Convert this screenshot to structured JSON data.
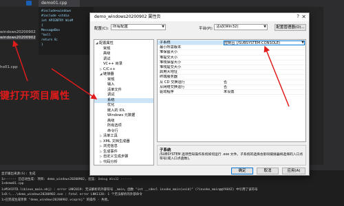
{
  "vs": {
    "tab": "demo01.cpp",
    "tree": {
      "project": "windows20200902",
      "selected": "windows20200902",
      "file": "ho01.cpp"
    },
    "code": [
      "#include<windows",
      "#include <stdio",
      "int APIENTRY WinM",
      "{",
      "MessageBox",
      "\"hell",
      "return 0;",
      "}"
    ],
    "annotation": "键打开项目属性",
    "output": {
      "lines": [
        "显示输出来源(S): 生成",
        "1>------ 已启动生成: 项目: demo_windows20200902, 配置: Debug Win32 ------",
        "1>demo01.cpp",
        "1>MSVCRTD.lib(exe_main.obj) : error LNK2019: 无法解析的外部符号 _main，函数 \"int __cdecl invoke_main(void)\" (?invoke_main@@YAHXZ) 中引用了该符号",
        "1>D:\\...\\demo_windows20200902.exe : fatal error LNK1120: 1 个无法解析的外部命令",
        "1>已完成生成项目 \"demo_windows20200902.vcxproj\" 的操作 - 失败。"
      ]
    }
  },
  "dialog": {
    "title": "demo_windows20200902 属性页",
    "help": "?",
    "close": "✕",
    "config_label": "配置(C):",
    "config_value": "所有配置",
    "platform_label": "平台(P):",
    "platform_value": "活动(Win32)",
    "config_manager": "配置管理器(O)...",
    "tree": [
      {
        "label": "配置属性",
        "level": 0,
        "arrow": "◢",
        "selected": false
      },
      {
        "label": "常规",
        "level": 1,
        "arrow": "",
        "selected": false
      },
      {
        "label": "高级",
        "level": 1,
        "arrow": "",
        "selected": false
      },
      {
        "label": "调试",
        "level": 1,
        "arrow": "",
        "selected": false
      },
      {
        "label": "VC++ 目录",
        "level": 1,
        "arrow": "",
        "selected": false
      },
      {
        "label": "C/C++",
        "level": 1,
        "arrow": "▷",
        "selected": false
      },
      {
        "label": "链接器",
        "level": 1,
        "arrow": "◢",
        "selected": false
      },
      {
        "label": "常规",
        "level": 2,
        "arrow": "",
        "selected": false
      },
      {
        "label": "输入",
        "level": 2,
        "arrow": "",
        "selected": false
      },
      {
        "label": "清单文件",
        "level": 2,
        "arrow": "",
        "selected": false
      },
      {
        "label": "调试",
        "level": 2,
        "arrow": "",
        "selected": false
      },
      {
        "label": "系统",
        "level": 2,
        "arrow": "",
        "selected": true
      },
      {
        "label": "优化",
        "level": 2,
        "arrow": "",
        "selected": false
      },
      {
        "label": "嵌入的 IDL",
        "level": 2,
        "arrow": "",
        "selected": false
      },
      {
        "label": "Windows 元数据",
        "level": 2,
        "arrow": "",
        "selected": false
      },
      {
        "label": "高级",
        "level": 2,
        "arrow": "",
        "selected": false
      },
      {
        "label": "所有选项",
        "level": 2,
        "arrow": "",
        "selected": false
      },
      {
        "label": "命令行",
        "level": 2,
        "arrow": "",
        "selected": false
      },
      {
        "label": "清单工具",
        "level": 1,
        "arrow": "▷",
        "selected": false
      },
      {
        "label": "XML 文档生成器",
        "level": 1,
        "arrow": "▷",
        "selected": false
      },
      {
        "label": "浏览信息",
        "level": 1,
        "arrow": "▷",
        "selected": false
      },
      {
        "label": "生成事件",
        "level": 1,
        "arrow": "▷",
        "selected": false
      },
      {
        "label": "自定义生成步骤",
        "level": 1,
        "arrow": "▷",
        "selected": false
      },
      {
        "label": "代码分析",
        "level": 1,
        "arrow": "▷",
        "selected": false
      }
    ],
    "properties": [
      {
        "key": "子系统",
        "value": "控制台 (/SUBSYSTEM:CONSOLE)",
        "selected": true
      },
      {
        "key": "最小所需版本",
        "value": "",
        "selected": false
      },
      {
        "key": "堆保留大小",
        "value": "",
        "selected": false
      },
      {
        "key": "堆提交大小",
        "value": "",
        "selected": false
      },
      {
        "key": "堆栈保留大小",
        "value": "",
        "selected": false
      },
      {
        "key": "堆栈提交大小",
        "value": "",
        "selected": false
      },
      {
        "key": "启用大地址",
        "value": "",
        "selected": false
      },
      {
        "key": "终端服务器",
        "value": "",
        "selected": false
      },
      {
        "key": "从 CD 交换运行",
        "value": "否",
        "selected": false
      },
      {
        "key": "从网络交换运行",
        "value": "否",
        "selected": false
      },
      {
        "key": "驱动程序",
        "value": "未设置",
        "selected": false
      }
    ],
    "desc_title": "子系统",
    "desc_text": "/SUBSYSTEM 选项告知操作系统如何运行 .exe 文件。子系统的选择会影响链接器将选择的入口点符号(或入口点函数)。",
    "ok": "确定",
    "cancel": "取消",
    "apply": "应用(A)"
  }
}
